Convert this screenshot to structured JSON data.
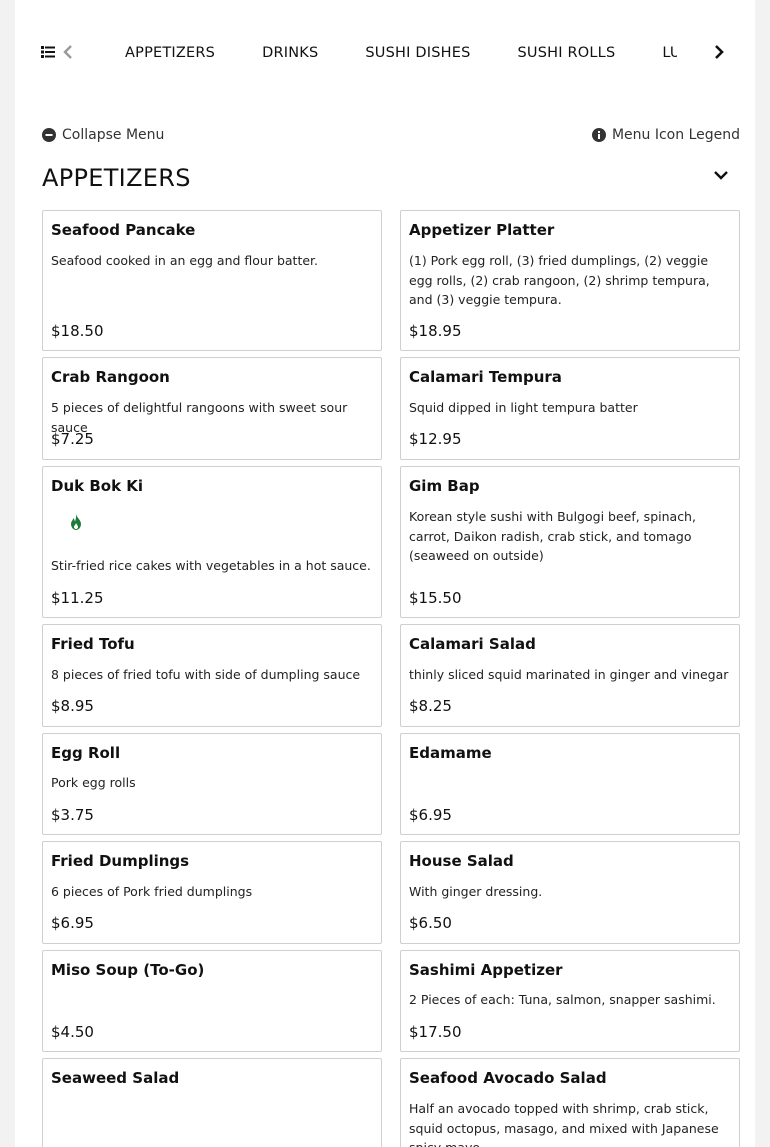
{
  "nav": {
    "tabs": [
      "APPETIZERS",
      "DRINKS",
      "SUSHI DISHES",
      "SUSHI ROLLS",
      "LUNCH"
    ]
  },
  "controls": {
    "collapse_label": "Collapse Menu",
    "legend_label": "Menu Icon Legend"
  },
  "section": {
    "title": "APPETIZERS"
  },
  "items": [
    {
      "name": "Seafood Pancake",
      "desc": "Seafood cooked in an egg and flour batter.",
      "price": "$18.50"
    },
    {
      "name": "Appetizer Platter",
      "desc": "(1) Pork egg roll, (3) fried dumplings, (2) veggie egg rolls, (2) crab rangoon, (2) shrimp tempura, and (3) veggie tempura.",
      "price": "$18.95"
    },
    {
      "name": "Crab Rangoon",
      "desc": "5 pieces of delightful rangoons with sweet sour sauce",
      "price": "$7.25"
    },
    {
      "name": "Calamari Tempura",
      "desc": "Squid dipped in light tempura batter",
      "price": "$12.95"
    },
    {
      "name": "Duk Bok Ki",
      "desc": "Stir-fried rice cakes with vegetables in a hot sauce.",
      "price": "$11.25",
      "icon": "spicy-flame-icon"
    },
    {
      "name": "Gim Bap",
      "desc": "Korean style sushi with Bulgogi beef, spinach, carrot, Daikon radish, crab stick, and tomago (seaweed on outside)",
      "price": "$15.50"
    },
    {
      "name": "Fried Tofu",
      "desc": "8 pieces of fried tofu with side of dumpling sauce",
      "price": "$8.95"
    },
    {
      "name": "Calamari Salad",
      "desc": "thinly sliced squid marinated in ginger and vinegar",
      "price": "$8.25"
    },
    {
      "name": "Egg Roll",
      "desc": "Pork egg rolls",
      "price": "$3.75"
    },
    {
      "name": "Edamame",
      "desc": "",
      "price": "$6.95"
    },
    {
      "name": "Fried Dumplings",
      "desc": "6 pieces of Pork fried dumplings",
      "price": "$6.95"
    },
    {
      "name": "House Salad",
      "desc": "With ginger dressing.",
      "price": "$6.50"
    },
    {
      "name": "Miso Soup (To-Go)",
      "desc": "",
      "price": "$4.50"
    },
    {
      "name": "Sashimi Appetizer",
      "desc": "2 Pieces of each: Tuna, salmon, snapper sashimi.",
      "price": "$17.50"
    },
    {
      "name": "Seaweed Salad",
      "desc": "",
      "price": ""
    },
    {
      "name": "Seafood Avocado Salad",
      "desc": "Half an avocado topped with shrimp, crab stick, squid octopus, masago, and mixed with Japanese spicy mayo.",
      "price": ""
    }
  ],
  "icons": {
    "list": "list-icon",
    "prev": "chevron-left-icon",
    "next": "chevron-right-icon",
    "collapse": "minus-circle-icon",
    "legend": "info-circle-icon",
    "toggle": "chevron-down-icon"
  },
  "colors": {
    "spicy": "#1f7a3a",
    "border": "#cfcfcf",
    "disabled": "#999999"
  }
}
